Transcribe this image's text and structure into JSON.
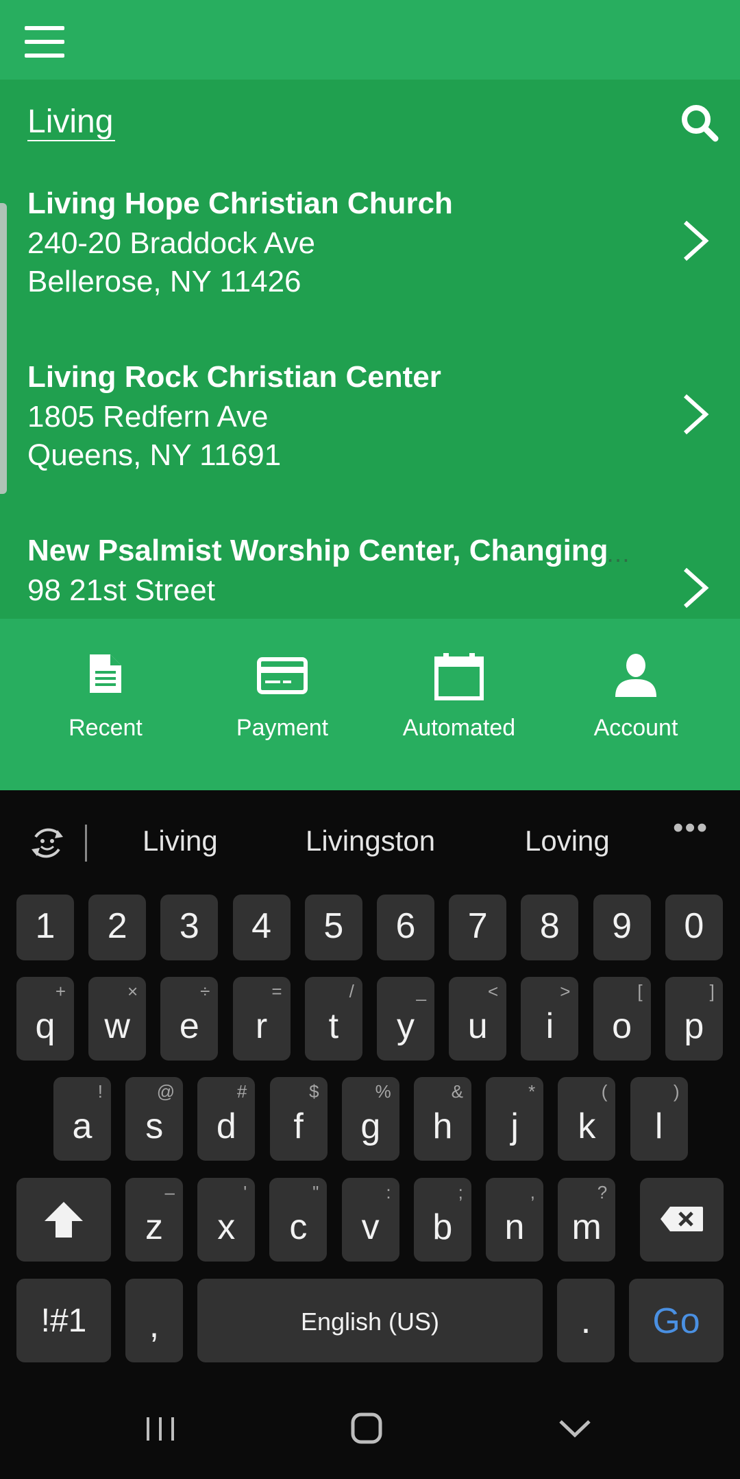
{
  "search": {
    "query": "Living"
  },
  "results": [
    {
      "name": "Living Hope Christian Church",
      "address_line1": "240-20 Braddock Ave",
      "address_line2": "Bellerose, NY 11426"
    },
    {
      "name": "Living Rock Christian Center",
      "address_line1": "1805 Redfern Ave",
      "address_line2": "Queens, NY 11691"
    },
    {
      "name": "New Psalmist Worship Center, Changing",
      "address_line1": "98 21st Street",
      "address_line2": ""
    }
  ],
  "tabs": [
    {
      "label": "Recent",
      "icon": "document-icon"
    },
    {
      "label": "Payment",
      "icon": "credit-card-icon"
    },
    {
      "label": "Automated",
      "icon": "calendar-icon"
    },
    {
      "label": "Account",
      "icon": "person-icon"
    }
  ],
  "keyboard": {
    "suggestions": [
      "Living",
      "Livingston",
      "Loving"
    ],
    "more": "•••",
    "numbers": [
      "1",
      "2",
      "3",
      "4",
      "5",
      "6",
      "7",
      "8",
      "9",
      "0"
    ],
    "row1": [
      {
        "k": "q",
        "s": "+"
      },
      {
        "k": "w",
        "s": "×"
      },
      {
        "k": "e",
        "s": "÷"
      },
      {
        "k": "r",
        "s": "="
      },
      {
        "k": "t",
        "s": "/"
      },
      {
        "k": "y",
        "s": "_"
      },
      {
        "k": "u",
        "s": "<"
      },
      {
        "k": "i",
        "s": ">"
      },
      {
        "k": "o",
        "s": "["
      },
      {
        "k": "p",
        "s": "]"
      }
    ],
    "row2": [
      {
        "k": "a",
        "s": "!"
      },
      {
        "k": "s",
        "s": "@"
      },
      {
        "k": "d",
        "s": "#"
      },
      {
        "k": "f",
        "s": "$"
      },
      {
        "k": "g",
        "s": "%"
      },
      {
        "k": "h",
        "s": "&"
      },
      {
        "k": "j",
        "s": "*"
      },
      {
        "k": "k",
        "s": "("
      },
      {
        "k": "l",
        "s": ")"
      }
    ],
    "row3": [
      {
        "k": "z",
        "s": "–"
      },
      {
        "k": "x",
        "s": "'"
      },
      {
        "k": "c",
        "s": "\""
      },
      {
        "k": "v",
        "s": ":"
      },
      {
        "k": "b",
        "s": ";"
      },
      {
        "k": "n",
        "s": ","
      },
      {
        "k": "m",
        "s": "?"
      }
    ],
    "symbols_label": "!#1",
    "comma": ",",
    "space_label": "English (US)",
    "period": ".",
    "go_label": "Go",
    "go_color": "#4a90e2"
  },
  "colors": {
    "header": "#28ae5f",
    "list": "#20a04f",
    "keyboard": "#0b0b0b",
    "key": "#323232"
  }
}
